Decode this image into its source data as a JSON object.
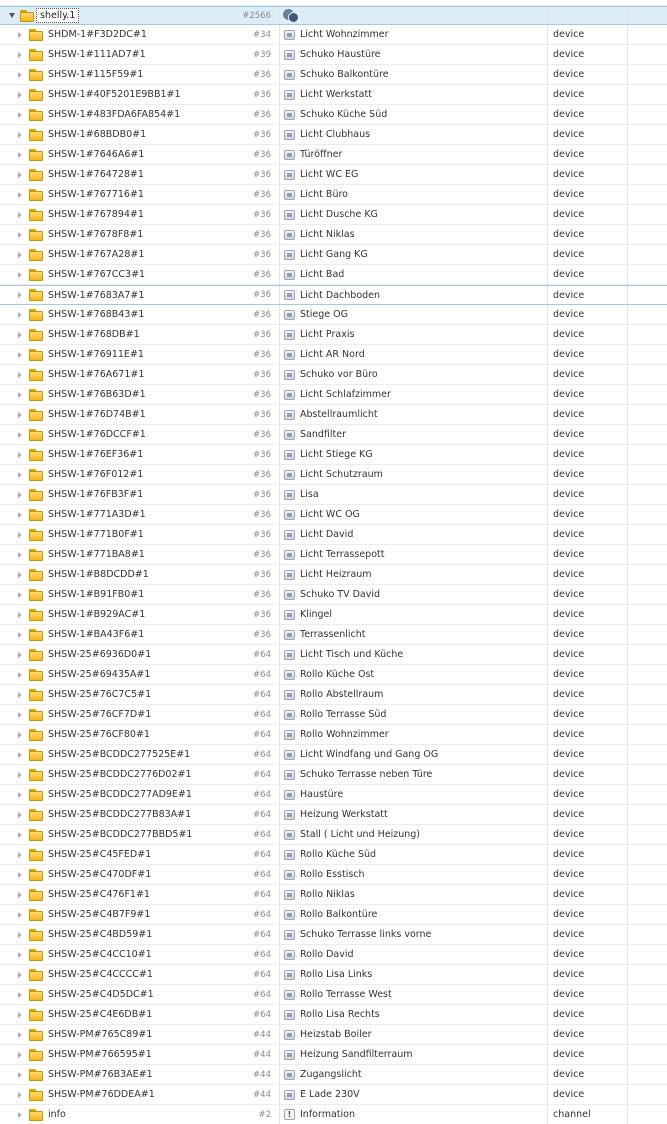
{
  "parent": {
    "label": "shelly.1",
    "count": "#2566"
  },
  "rows": [
    {
      "id": "SHDM-1#F3D2DC#1",
      "count": "#34",
      "name": "Licht Wohnzimmer",
      "type": "device",
      "icon": "state-icon"
    },
    {
      "id": "SHSW-1#111AD7#1",
      "count": "#39",
      "name": "Schuko Haustüre",
      "type": "device",
      "icon": "state-icon"
    },
    {
      "id": "SHSW-1#115F59#1",
      "count": "#36",
      "name": "Schuko Balkontüre",
      "type": "device",
      "icon": "state-icon"
    },
    {
      "id": "SHSW-1#40F5201E9BB1#1",
      "count": "#36",
      "name": "Licht Werkstatt",
      "type": "device",
      "icon": "state-icon"
    },
    {
      "id": "SHSW-1#483FDA6FA854#1",
      "count": "#36",
      "name": "Schuko Küche Süd",
      "type": "device",
      "icon": "state-icon"
    },
    {
      "id": "SHSW-1#68BDB0#1",
      "count": "#36",
      "name": "Licht Clubhaus",
      "type": "device",
      "icon": "state-icon"
    },
    {
      "id": "SHSW-1#7646A6#1",
      "count": "#36",
      "name": "Türöffner",
      "type": "device",
      "icon": "state-icon"
    },
    {
      "id": "SHSW-1#764728#1",
      "count": "#36",
      "name": "Licht WC EG",
      "type": "device",
      "icon": "state-icon"
    },
    {
      "id": "SHSW-1#767716#1",
      "count": "#36",
      "name": "Licht Büro",
      "type": "device",
      "icon": "state-icon"
    },
    {
      "id": "SHSW-1#767894#1",
      "count": "#36",
      "name": "Licht Dusche KG",
      "type": "device",
      "icon": "state-icon"
    },
    {
      "id": "SHSW-1#7678F8#1",
      "count": "#36",
      "name": "Licht Niklas",
      "type": "device",
      "icon": "state-icon"
    },
    {
      "id": "SHSW-1#767A28#1",
      "count": "#36",
      "name": "Licht Gang KG",
      "type": "device",
      "icon": "state-icon"
    },
    {
      "id": "SHSW-1#767CC3#1",
      "count": "#36",
      "name": "Licht Bad",
      "type": "device",
      "icon": "state-icon"
    },
    {
      "id": "SHSW-1#7683A7#1",
      "count": "#36",
      "name": "Licht Dachboden",
      "type": "device",
      "icon": "state-icon",
      "selected": true
    },
    {
      "id": "SHSW-1#768B43#1",
      "count": "#36",
      "name": "Stiege OG",
      "type": "device",
      "icon": "state-icon"
    },
    {
      "id": "SHSW-1#768DB#1",
      "count": "#36",
      "name": "Licht Praxis",
      "type": "device",
      "icon": "state-icon"
    },
    {
      "id": "SHSW-1#76911E#1",
      "count": "#36",
      "name": "Licht AR Nord",
      "type": "device",
      "icon": "state-icon"
    },
    {
      "id": "SHSW-1#76A671#1",
      "count": "#36",
      "name": "Schuko vor Büro",
      "type": "device",
      "icon": "state-icon"
    },
    {
      "id": "SHSW-1#76B63D#1",
      "count": "#36",
      "name": "Licht Schlafzimmer",
      "type": "device",
      "icon": "state-icon"
    },
    {
      "id": "SHSW-1#76D74B#1",
      "count": "#36",
      "name": "Abstellraumlicht",
      "type": "device",
      "icon": "state-icon"
    },
    {
      "id": "SHSW-1#76DCCF#1",
      "count": "#36",
      "name": "Sandfilter",
      "type": "device",
      "icon": "state-icon"
    },
    {
      "id": "SHSW-1#76EF36#1",
      "count": "#36",
      "name": "Licht Stiege KG",
      "type": "device",
      "icon": "state-icon"
    },
    {
      "id": "SHSW-1#76F012#1",
      "count": "#36",
      "name": "Licht Schutzraum",
      "type": "device",
      "icon": "state-icon"
    },
    {
      "id": "SHSW-1#76FB3F#1",
      "count": "#36",
      "name": "Lisa",
      "type": "device",
      "icon": "state-icon"
    },
    {
      "id": "SHSW-1#771A3D#1",
      "count": "#36",
      "name": "Licht WC OG",
      "type": "device",
      "icon": "state-icon"
    },
    {
      "id": "SHSW-1#771B0F#1",
      "count": "#36",
      "name": "Licht David",
      "type": "device",
      "icon": "state-icon"
    },
    {
      "id": "SHSW-1#771BA8#1",
      "count": "#36",
      "name": "Licht Terrassepott",
      "type": "device",
      "icon": "state-icon"
    },
    {
      "id": "SHSW-1#B8DCDD#1",
      "count": "#36",
      "name": "Licht Heizraum",
      "type": "device",
      "icon": "state-icon"
    },
    {
      "id": "SHSW-1#B91FB0#1",
      "count": "#36",
      "name": "Schuko TV David",
      "type": "device",
      "icon": "state-icon"
    },
    {
      "id": "SHSW-1#B929AC#1",
      "count": "#36",
      "name": "Klingel",
      "type": "device",
      "icon": "state-icon"
    },
    {
      "id": "SHSW-1#BA43F6#1",
      "count": "#36",
      "name": "Terrassenlicht",
      "type": "device",
      "icon": "state-icon"
    },
    {
      "id": "SHSW-25#6936D0#1",
      "count": "#64",
      "name": "Licht Tisch und Küche",
      "type": "device",
      "icon": "state-icon"
    },
    {
      "id": "SHSW-25#69435A#1",
      "count": "#64",
      "name": "Rollo Küche Ost",
      "type": "device",
      "icon": "state-icon"
    },
    {
      "id": "SHSW-25#76C7C5#1",
      "count": "#64",
      "name": "Rollo Abstellraum",
      "type": "device",
      "icon": "state-icon"
    },
    {
      "id": "SHSW-25#76CF7D#1",
      "count": "#64",
      "name": "Rollo Terrasse Süd",
      "type": "device",
      "icon": "state-icon"
    },
    {
      "id": "SHSW-25#76CF80#1",
      "count": "#64",
      "name": "Rollo Wohnzimmer",
      "type": "device",
      "icon": "state-icon"
    },
    {
      "id": "SHSW-25#BCDDC277525E#1",
      "count": "#64",
      "name": "Licht Windfang und Gang OG",
      "type": "device",
      "icon": "state-icon"
    },
    {
      "id": "SHSW-25#BCDDC2776D02#1",
      "count": "#64",
      "name": "Schuko Terrasse neben Türe",
      "type": "device",
      "icon": "state-icon"
    },
    {
      "id": "SHSW-25#BCDDC277AD9E#1",
      "count": "#64",
      "name": "Haustüre",
      "type": "device",
      "icon": "state-icon"
    },
    {
      "id": "SHSW-25#BCDDC277B83A#1",
      "count": "#64",
      "name": "Heizung Werkstatt",
      "type": "device",
      "icon": "state-icon"
    },
    {
      "id": "SHSW-25#BCDDC277BBD5#1",
      "count": "#64",
      "name": "Stall ( Licht und Heizung)",
      "type": "device",
      "icon": "state-icon"
    },
    {
      "id": "SHSW-25#C45FED#1",
      "count": "#64",
      "name": "Rollo Küche Süd",
      "type": "device",
      "icon": "state-icon"
    },
    {
      "id": "SHSW-25#C470DF#1",
      "count": "#64",
      "name": "Rollo Esstisch",
      "type": "device",
      "icon": "state-icon"
    },
    {
      "id": "SHSW-25#C476F1#1",
      "count": "#64",
      "name": "Rollo Niklas",
      "type": "device",
      "icon": "state-icon"
    },
    {
      "id": "SHSW-25#C4B7F9#1",
      "count": "#64",
      "name": "Rollo Balkontüre",
      "type": "device",
      "icon": "state-icon"
    },
    {
      "id": "SHSW-25#C4BD59#1",
      "count": "#64",
      "name": "Schuko Terrasse links vorne",
      "type": "device",
      "icon": "state-icon"
    },
    {
      "id": "SHSW-25#C4CC10#1",
      "count": "#64",
      "name": "Rollo David",
      "type": "device",
      "icon": "state-icon"
    },
    {
      "id": "SHSW-25#C4CCCC#1",
      "count": "#64",
      "name": "Rollo Lisa Links",
      "type": "device",
      "icon": "state-icon"
    },
    {
      "id": "SHSW-25#C4D5DC#1",
      "count": "#64",
      "name": "Rollo Terrasse West",
      "type": "device",
      "icon": "state-icon"
    },
    {
      "id": "SHSW-25#C4E6DB#1",
      "count": "#64",
      "name": "Rollo Lisa Rechts",
      "type": "device",
      "icon": "state-icon"
    },
    {
      "id": "SHSW-PM#765C89#1",
      "count": "#44",
      "name": "Heizstab Boiler",
      "type": "device",
      "icon": "state-icon"
    },
    {
      "id": "SHSW-PM#766595#1",
      "count": "#44",
      "name": "Heizung Sandfilterraum",
      "type": "device",
      "icon": "state-icon"
    },
    {
      "id": "SHSW-PM#76B3AE#1",
      "count": "#44",
      "name": "Zugangslicht",
      "type": "device",
      "icon": "state-icon"
    },
    {
      "id": "SHSW-PM#76DDEA#1",
      "count": "#44",
      "name": "E Lade 230V",
      "type": "device",
      "icon": "state-icon"
    },
    {
      "id": "info",
      "count": "#2",
      "name": "Information",
      "type": "channel",
      "icon": "info-icon"
    }
  ]
}
